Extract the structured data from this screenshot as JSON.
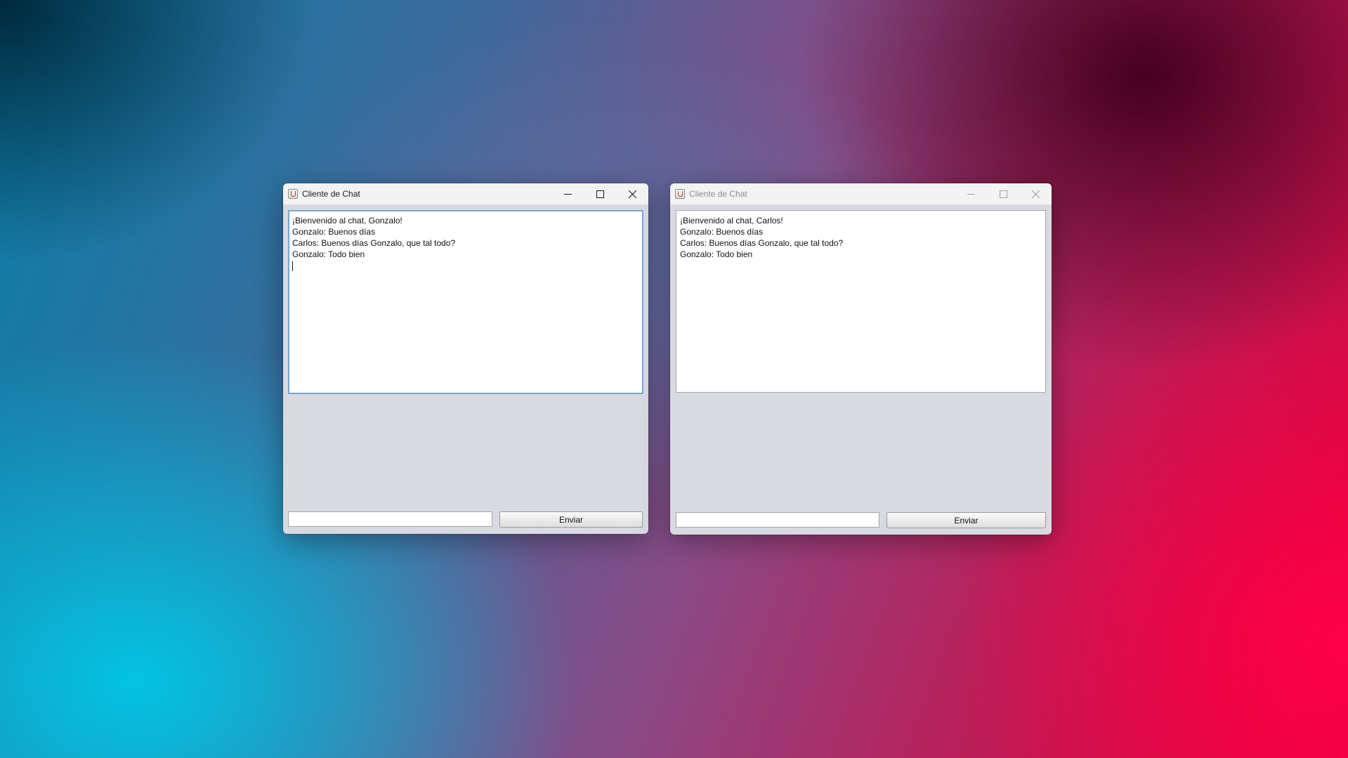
{
  "windows": [
    {
      "title": "Cliente de Chat",
      "state": "active",
      "messages": [
        "¡Bienvenido al chat, Gonzalo!",
        "Gonzalo: Buenos días",
        "Carlos: Buenos días Gonzalo, que tal todo?",
        "Gonzalo: Todo bien"
      ],
      "input_value": "",
      "send_label": "Enviar"
    },
    {
      "title": "Cliente de Chat",
      "state": "inactive",
      "messages": [
        "¡Bienvenido al chat, Carlos!",
        "Gonzalo: Buenos días",
        "Carlos: Buenos días Gonzalo, que tal todo?",
        "Gonzalo: Todo bien"
      ],
      "input_value": "",
      "send_label": "Enviar"
    }
  ],
  "icons": {
    "app": "java-app-icon",
    "minimize": "minimize-icon",
    "maximize": "maximize-icon",
    "close": "close-icon"
  }
}
